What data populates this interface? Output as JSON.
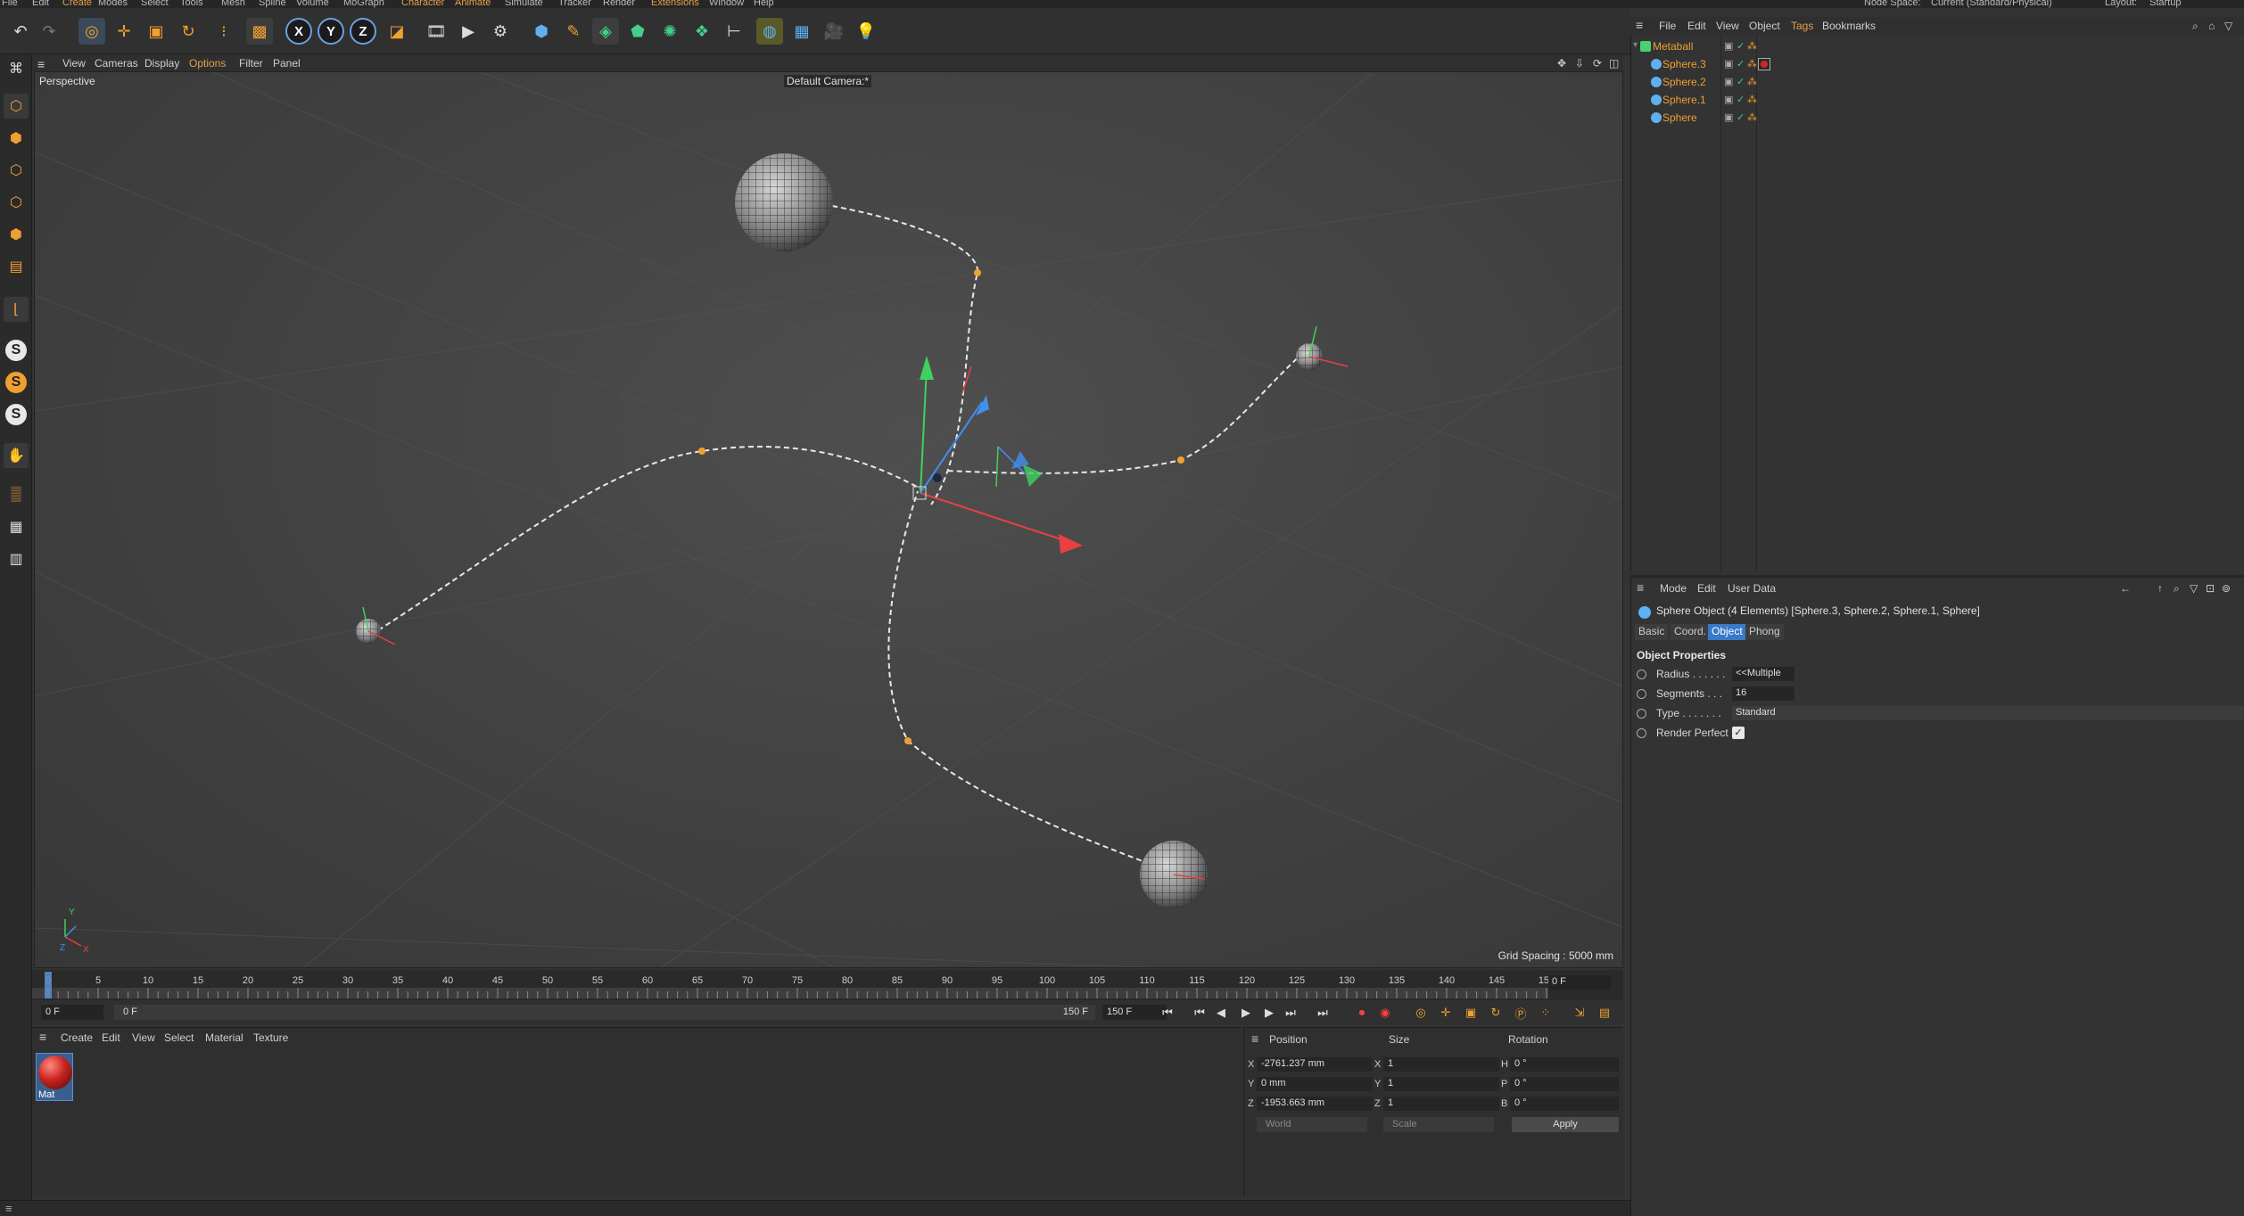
{
  "top_menu": {
    "items": [
      "File",
      "Edit",
      "Create",
      "Modes",
      "Select",
      "Tools",
      "Mesh",
      "Spline",
      "Volume",
      "MoGraph",
      "Character",
      "Animate",
      "Simulate",
      "Tracker",
      "Render",
      "Extensions",
      "Window",
      "Help"
    ],
    "node_space_label": "Node Space:",
    "node_space_value": "Current (Standard/Physical)",
    "layout_label": "Layout:",
    "layout_value": "Startup"
  },
  "toolbar": {
    "icons": [
      "undo-icon",
      "redo-icon",
      "live-selection-icon",
      "move-icon",
      "scale-icon",
      "rotate-icon",
      "recent-tools-icon",
      "object-mode-icon",
      "x-axis-icon",
      "y-axis-icon",
      "z-axis-icon",
      "coordinate-system-icon",
      "render-view-icon",
      "render-picture-viewer-icon",
      "render-settings-icon",
      "cube-icon",
      "pen-icon",
      "subdivision-icon",
      "extrude-icon",
      "cloner-icon",
      "mograph-icon",
      "deformer-icon",
      "field-icon",
      "floor-icon",
      "camera-icon",
      "light-icon"
    ],
    "axis_labels": {
      "x": "X",
      "y": "Y",
      "z": "Z"
    }
  },
  "viewport": {
    "menu": [
      "View",
      "Cameras",
      "Display",
      "Options",
      "Filter",
      "Panel"
    ],
    "view_name": "Perspective",
    "camera_name": "Default Camera:*",
    "grid_spacing": "Grid Spacing : 5000 mm"
  },
  "timeline": {
    "ticks": [
      "0",
      "5",
      "10",
      "15",
      "20",
      "25",
      "30",
      "35",
      "40",
      "45",
      "50",
      "55",
      "60",
      "65",
      "70",
      "75",
      "80",
      "85",
      "90",
      "95",
      "100",
      "105",
      "110",
      "115",
      "120",
      "125",
      "130",
      "135",
      "140",
      "145",
      "150"
    ],
    "current_frame": "0 F",
    "start_field": "0 F",
    "range_start": "0 F",
    "range_end": "150 F",
    "end_field": "150 F"
  },
  "materials": {
    "menu": [
      "Create",
      "Edit",
      "View",
      "Select",
      "Material",
      "Texture"
    ],
    "items": [
      {
        "name": "Mat",
        "color": "#c8241e"
      }
    ]
  },
  "coordinates": {
    "headers": [
      "Position",
      "Size",
      "Rotation"
    ],
    "rows": [
      {
        "pos_axis": "X",
        "pos": "-2761.237 mm",
        "size_axis": "X",
        "size": "1",
        "rot_axis": "H",
        "rot": "0 °"
      },
      {
        "pos_axis": "Y",
        "pos": "0 mm",
        "size_axis": "Y",
        "size": "1",
        "rot_axis": "P",
        "rot": "0 °"
      },
      {
        "pos_axis": "Z",
        "pos": "-1953.663 mm",
        "size_axis": "Z",
        "size": "1",
        "rot_axis": "B",
        "rot": "0 °"
      }
    ],
    "space_dropdown": "World",
    "scale_dropdown": "Scale",
    "apply_label": "Apply"
  },
  "object_manager": {
    "menu": [
      "File",
      "Edit",
      "View",
      "Object",
      "Tags",
      "Bookmarks"
    ],
    "objects": [
      {
        "name": "Metaball",
        "root": true
      },
      {
        "name": "Sphere.3",
        "root": false,
        "material": true
      },
      {
        "name": "Sphere.2",
        "root": false,
        "material": false
      },
      {
        "name": "Sphere.1",
        "root": false,
        "material": false
      },
      {
        "name": "Sphere",
        "root": false,
        "material": false
      }
    ]
  },
  "attribute_manager": {
    "menu": [
      "Mode",
      "Edit",
      "User Data"
    ],
    "title": "Sphere Object (4 Elements) [Sphere.3, Sphere.2, Sphere.1, Sphere]",
    "tabs": [
      "Basic",
      "Coord.",
      "Object",
      "Phong"
    ],
    "active_tab": "Object",
    "section": "Object Properties",
    "properties": [
      {
        "label": "Radius . . . . . .",
        "value": "<<Multiple"
      },
      {
        "label": "Segments . . .",
        "value": "16"
      },
      {
        "label": "Type . . . . . . .",
        "value": "Standard"
      },
      {
        "label": "Render Perfect",
        "checked": true
      }
    ]
  },
  "colors": {
    "accent_orange": "#f0a030",
    "selection_blue": "#3a78c8",
    "axis_x": "#e84040",
    "axis_y": "#40d060",
    "axis_z": "#4090f0"
  }
}
